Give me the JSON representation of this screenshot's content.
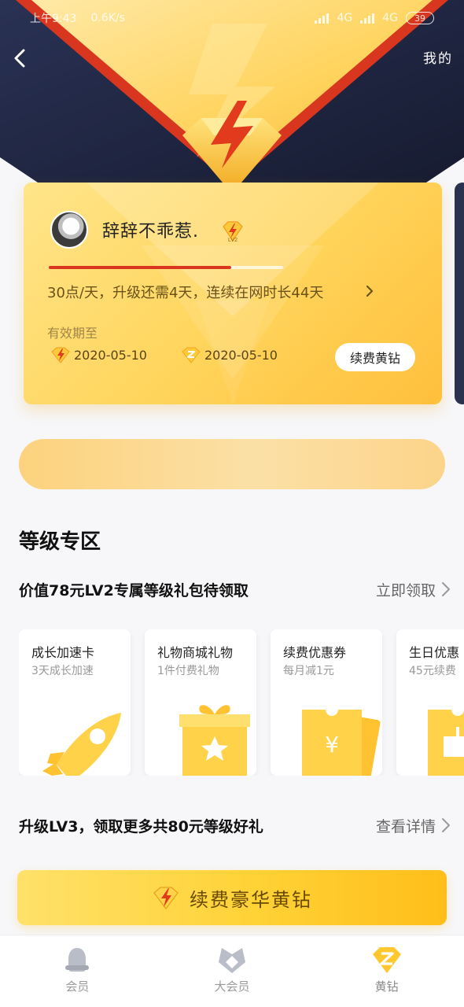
{
  "status_bar": {
    "time": "上午9:43",
    "speed": "0.6K/s",
    "network1": "4G",
    "network2": "4G",
    "battery": "39"
  },
  "header": {
    "back_icon": "chevron-left-icon",
    "right_label": "我的"
  },
  "member_card": {
    "username": "辞辞不乖惹.",
    "level_badge": "LV2",
    "level_progress": 0.78,
    "points_text": "30点/天，升级还需4天，连续在网时长44天",
    "validity_label": "有效期至",
    "vip_dates": [
      {
        "icon": "lightning-diamond-icon",
        "date": "2020-05-10"
      },
      {
        "icon": "z-diamond-icon",
        "date": "2020-05-10"
      }
    ],
    "renew_label": "续费黄钻"
  },
  "level_zone": {
    "title": "等级专区",
    "gift_title": "价值78元LV2专属等级礼包待领取",
    "gift_action": "立即领取",
    "benefits": [
      {
        "title": "成长加速卡",
        "subtitle": "3天成长加速",
        "icon": "rocket-icon"
      },
      {
        "title": "礼物商城礼物",
        "subtitle": "1件付费礼物",
        "icon": "gift-box-icon"
      },
      {
        "title": "续费优惠券",
        "subtitle": "每月减1元",
        "icon": "coupon-icon"
      },
      {
        "title": "生日优惠",
        "subtitle": "45元续费",
        "icon": "cake-icon"
      }
    ],
    "upgrade_title": "升级LV3，领取更多共80元等级好礼",
    "upgrade_action": "查看详情"
  },
  "cta": {
    "label": "续费豪华黄钻"
  },
  "tabbar": {
    "tabs": [
      {
        "label": "会员",
        "icon": "member-icon"
      },
      {
        "label": "大会员",
        "icon": "big-member-icon"
      },
      {
        "label": "黄钻",
        "icon": "yellow-diamond-icon"
      }
    ],
    "active_index": 2
  },
  "colors": {
    "gold": "#ffd45a",
    "navy": "#1f2640",
    "red_accent": "#d9351f",
    "cta": "#ffd236"
  }
}
